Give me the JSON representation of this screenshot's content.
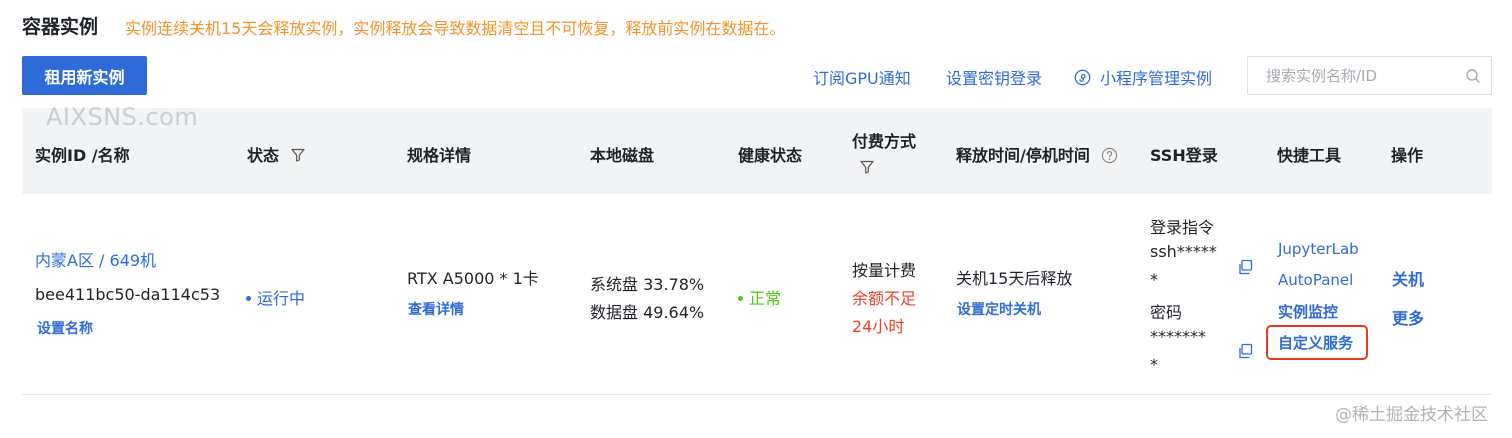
{
  "header": {
    "title": "容器实例",
    "warning": "实例连续关机15天会释放实例，实例释放会导致数据清空且不可恢复，释放前实例在数据在。"
  },
  "toolbar": {
    "rent_label": "租用新实例",
    "subscribe_label": "订阅GPU通知",
    "ssh_key_label": "设置密钥登录",
    "mini_program_label": "小程序管理实例",
    "search_placeholder": "搜索实例名称/ID"
  },
  "watermarks": {
    "top": "AIXSNS.com",
    "bottom": "@稀土掘金技术社区"
  },
  "columns": {
    "id_name": "实例ID /名称",
    "status": "状态",
    "spec": "规格详情",
    "disk": "本地磁盘",
    "health": "健康状态",
    "billing_line1": "付费方式",
    "release": "释放时间/停机时间",
    "ssh": "SSH登录",
    "tools": "快捷工具",
    "ops": "操作"
  },
  "row": {
    "region_name": "内蒙A区 / 649机",
    "instance_id": "bee411bc50-da114c53",
    "set_name": "设置名称",
    "status": "运行中",
    "gpu": "RTX A5000 * 1卡",
    "view_details": "查看详情",
    "system_disk": "系统盘 33.78%",
    "data_disk": "数据盘 49.64%",
    "health": "正常",
    "billing": "按量计费",
    "balance_line1": "余额不足",
    "balance_line2": "24小时",
    "release_text": "关机15天后释放",
    "set_timer": "设置定时关机",
    "ssh_cmd_label": "登录指令",
    "ssh_cmd_line1": "ssh*****",
    "ssh_cmd_line2": "*",
    "ssh_pwd_label": "密码",
    "ssh_pwd_line1": "*******",
    "ssh_pwd_line2": "*",
    "tool_jupyter": "JupyterLab",
    "tool_autopanel": "AutoPanel",
    "tool_monitor": "实例监控",
    "tool_custom": "自定义服务",
    "op_shutdown": "关机",
    "op_more": "更多"
  },
  "colors": {
    "primary": "#2f6bd8",
    "warning": "#f0932b",
    "running": "#2f6bd8",
    "healthy": "#52c41a",
    "danger": "#e8412c",
    "highlight_box": "#e23b1d"
  }
}
